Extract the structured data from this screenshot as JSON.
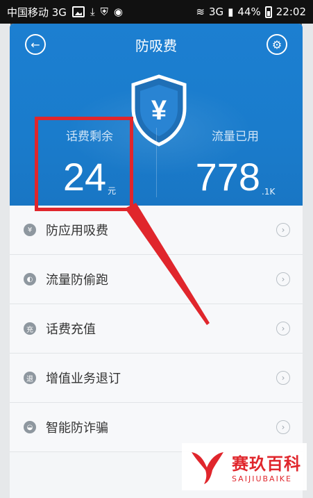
{
  "status_bar": {
    "carrier": "中国移动 3G",
    "network": "3G",
    "battery": "44%",
    "time": "22:02"
  },
  "header": {
    "title": "防吸费",
    "back_icon": "back-arrow-icon",
    "settings_icon": "settings-icon"
  },
  "stats": {
    "balance_label": "话费剩余",
    "balance_value": "24",
    "balance_unit": "元",
    "traffic_label": "流量已用",
    "traffic_value": "778",
    "traffic_unit": ".1K"
  },
  "menu": [
    {
      "label": "防应用吸费",
      "icon": "yen-shield-icon",
      "icon_glyph": "¥"
    },
    {
      "label": "流量防偷跑",
      "icon": "traffic-icon",
      "icon_glyph": "◐"
    },
    {
      "label": "话费充值",
      "icon": "recharge-icon",
      "icon_glyph": "充"
    },
    {
      "label": "增值业务退订",
      "icon": "unsubscribe-icon",
      "icon_glyph": "退"
    },
    {
      "label": "智能防诈骗",
      "icon": "anti-fraud-icon",
      "icon_glyph": "◒"
    }
  ],
  "watermark": {
    "cn": "赛玖百科",
    "en": "SAIJIUBAIKE"
  },
  "colors": {
    "header_blue": "#1a7ccc",
    "annotation_red": "#e0262c"
  }
}
